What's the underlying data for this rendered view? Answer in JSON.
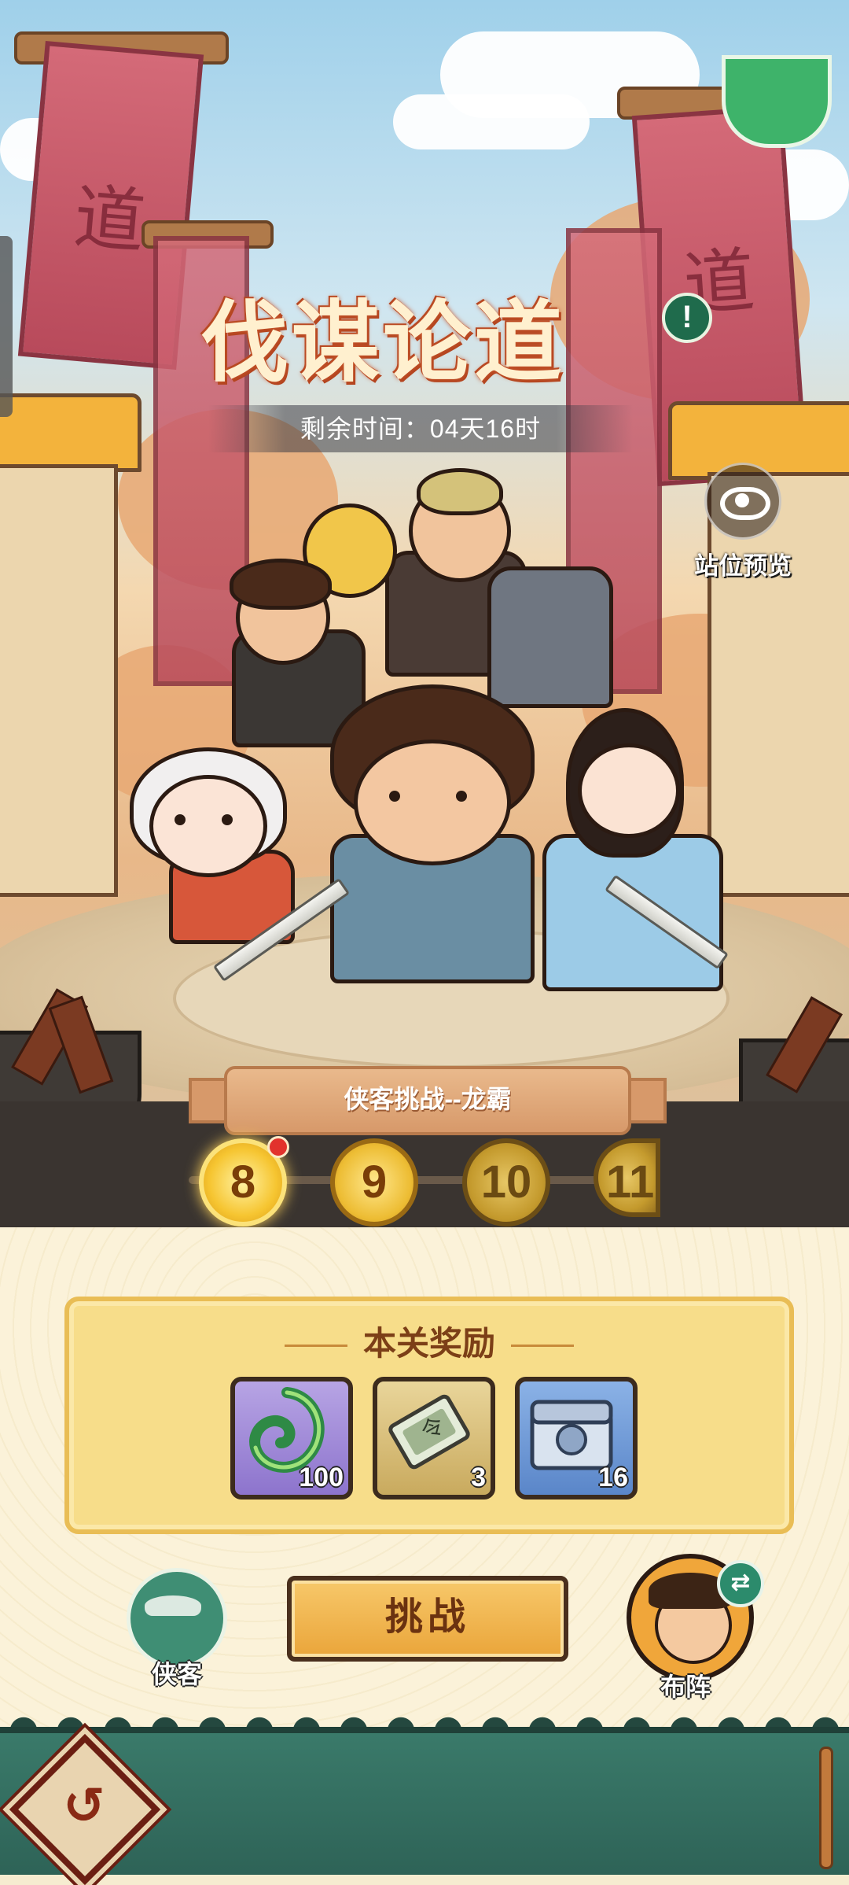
{
  "header": {
    "title": "伐谋论道",
    "info_symbol": "!",
    "remaining_time": "剩余时间：04天16时"
  },
  "side_actions": {
    "position_preview_label": "站位预览"
  },
  "stage": {
    "challenge_name": "侠客挑战--龙霸",
    "levels": [
      {
        "number": "8",
        "state": "current",
        "has_notification": true
      },
      {
        "number": "9",
        "state": "available"
      },
      {
        "number": "10",
        "state": "locked"
      },
      {
        "number": "11",
        "state": "locked"
      }
    ]
  },
  "rewards": {
    "title": "本关奖励",
    "items": [
      {
        "icon": "green-jade-icon",
        "count": "100",
        "color": "#9a85d8"
      },
      {
        "icon": "command-token-icon",
        "count": "3",
        "color": "#d8c27c"
      },
      {
        "icon": "blue-chest-icon",
        "count": "16",
        "color": "#6f98d6"
      }
    ]
  },
  "actions": {
    "hero_label": "侠客",
    "challenge_label": "挑战",
    "formation_label": "布阵",
    "swap_symbol": "⇄",
    "back_symbol": "↺"
  },
  "colors": {
    "accent_gold": "#f6c531",
    "panel_bg": "#f7dd8a",
    "bottom_bar": "#2e6357"
  }
}
